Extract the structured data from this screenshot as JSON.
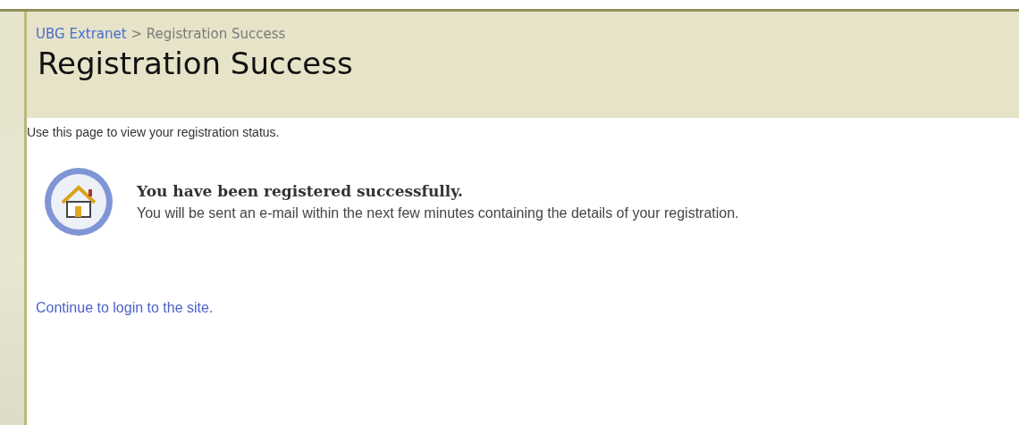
{
  "breadcrumb": {
    "site": "UBG Extranet",
    "separator": ">",
    "current": "Registration Success"
  },
  "title": "Registration Success",
  "intro": "Use this page to view your registration status.",
  "message": {
    "heading": "You have been registered successfully.",
    "detail": "You will be sent an e-mail within the next few minutes containing the details of your registration."
  },
  "link": "Continue to login to the site."
}
